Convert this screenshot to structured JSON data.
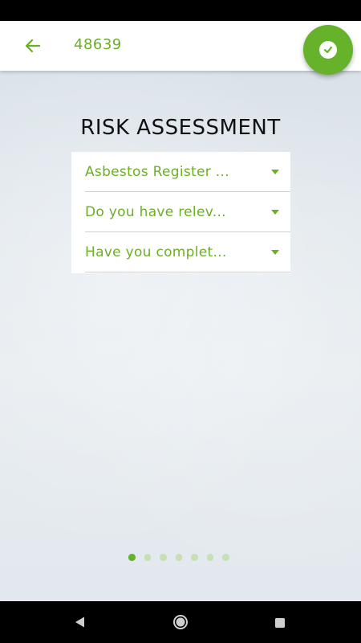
{
  "app_bar": {
    "title": "48639",
    "back_icon": "arrow-left-icon"
  },
  "fab": {
    "icon": "check-circle-icon"
  },
  "section": {
    "title": "RISK ASSESSMENT"
  },
  "dropdowns": [
    {
      "label": "Asbestos Register ..."
    },
    {
      "label": "Do you have relev..."
    },
    {
      "label": "Have you complet..."
    }
  ],
  "pager": {
    "total": 7,
    "active_index": 0
  },
  "colors": {
    "accent": "#66b22a",
    "accent_text": "#6ab023"
  },
  "nav": {
    "back_icon": "nav-back-icon",
    "home_icon": "nav-home-icon",
    "recents_icon": "nav-recents-icon"
  }
}
